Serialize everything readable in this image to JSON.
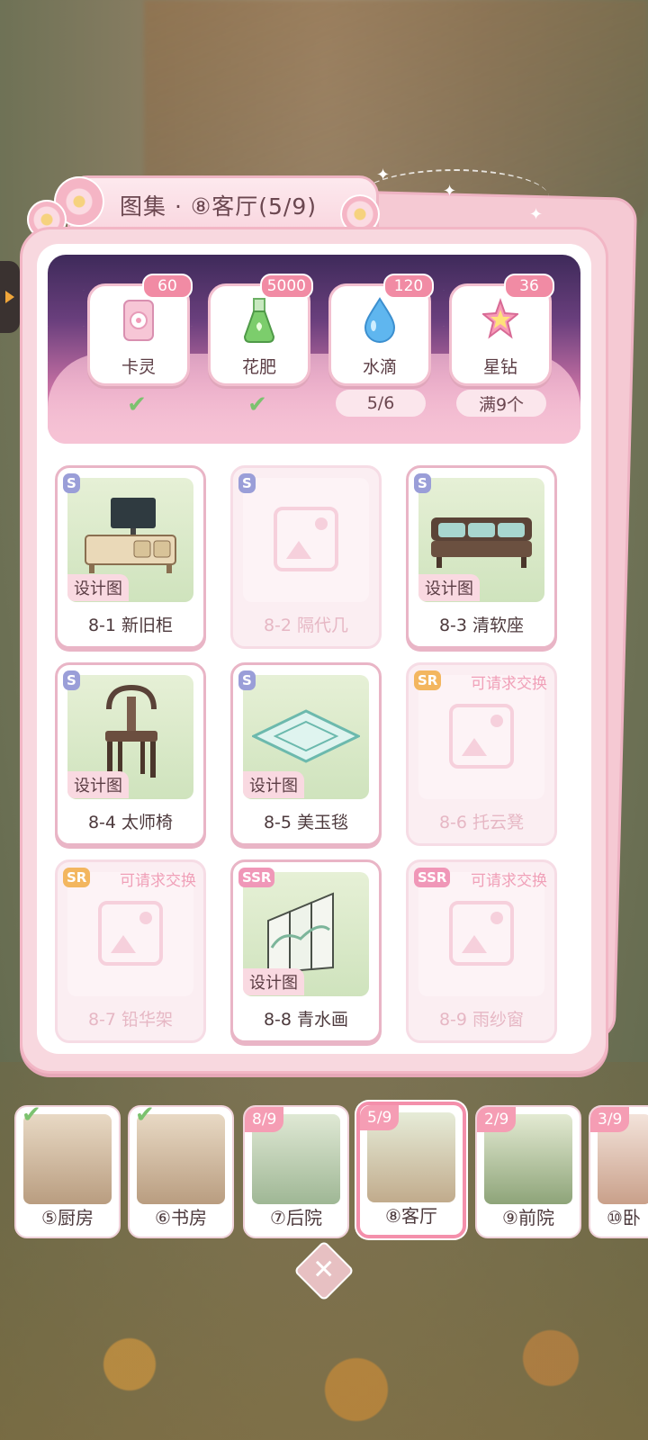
{
  "title": "图集 · ⑧客厅(5/9)",
  "materials": [
    {
      "label": "卡灵",
      "count": "60",
      "icon": "card-spirit-icon",
      "status": "check"
    },
    {
      "label": "花肥",
      "count": "5000",
      "icon": "fertilizer-flask-icon",
      "status": "check"
    },
    {
      "label": "水滴",
      "count": "120",
      "icon": "water-drop-icon",
      "status": "5/6"
    },
    {
      "label": "星钻",
      "count": "36",
      "icon": "star-diamond-icon",
      "status": "满9个"
    }
  ],
  "items": [
    {
      "name": "8-1 新旧柜",
      "rarity": "S",
      "tag": "设计图",
      "unlocked": true
    },
    {
      "name": "8-2 隔代几",
      "rarity": "S",
      "tag": "",
      "unlocked": false
    },
    {
      "name": "8-3 清软座",
      "rarity": "S",
      "tag": "设计图",
      "unlocked": true
    },
    {
      "name": "8-4 太师椅",
      "rarity": "S",
      "tag": "设计图",
      "unlocked": true
    },
    {
      "name": "8-5 美玉毯",
      "rarity": "S",
      "tag": "设计图",
      "unlocked": true
    },
    {
      "name": "8-6 托云凳",
      "rarity": "SR",
      "exchange": "可请求交换",
      "unlocked": false
    },
    {
      "name": "8-7 铅华架",
      "rarity": "SR",
      "exchange": "可请求交换",
      "unlocked": false
    },
    {
      "name": "8-8 青水画",
      "rarity": "SSR",
      "tag": "设计图",
      "unlocked": true
    },
    {
      "name": "8-9 雨纱窗",
      "rarity": "SSR",
      "exchange": "可请求交换",
      "unlocked": false
    }
  ],
  "rooms": [
    {
      "name": "⑤厨房",
      "badge": "",
      "complete": true
    },
    {
      "name": "⑥书房",
      "badge": "",
      "complete": true
    },
    {
      "name": "⑦后院",
      "badge": "8/9"
    },
    {
      "name": "⑧客厅",
      "badge": "5/9",
      "active": true
    },
    {
      "name": "⑨前院",
      "badge": "2/9"
    },
    {
      "name": "⑩卧",
      "badge": "3/9"
    }
  ],
  "close_label": "✕"
}
